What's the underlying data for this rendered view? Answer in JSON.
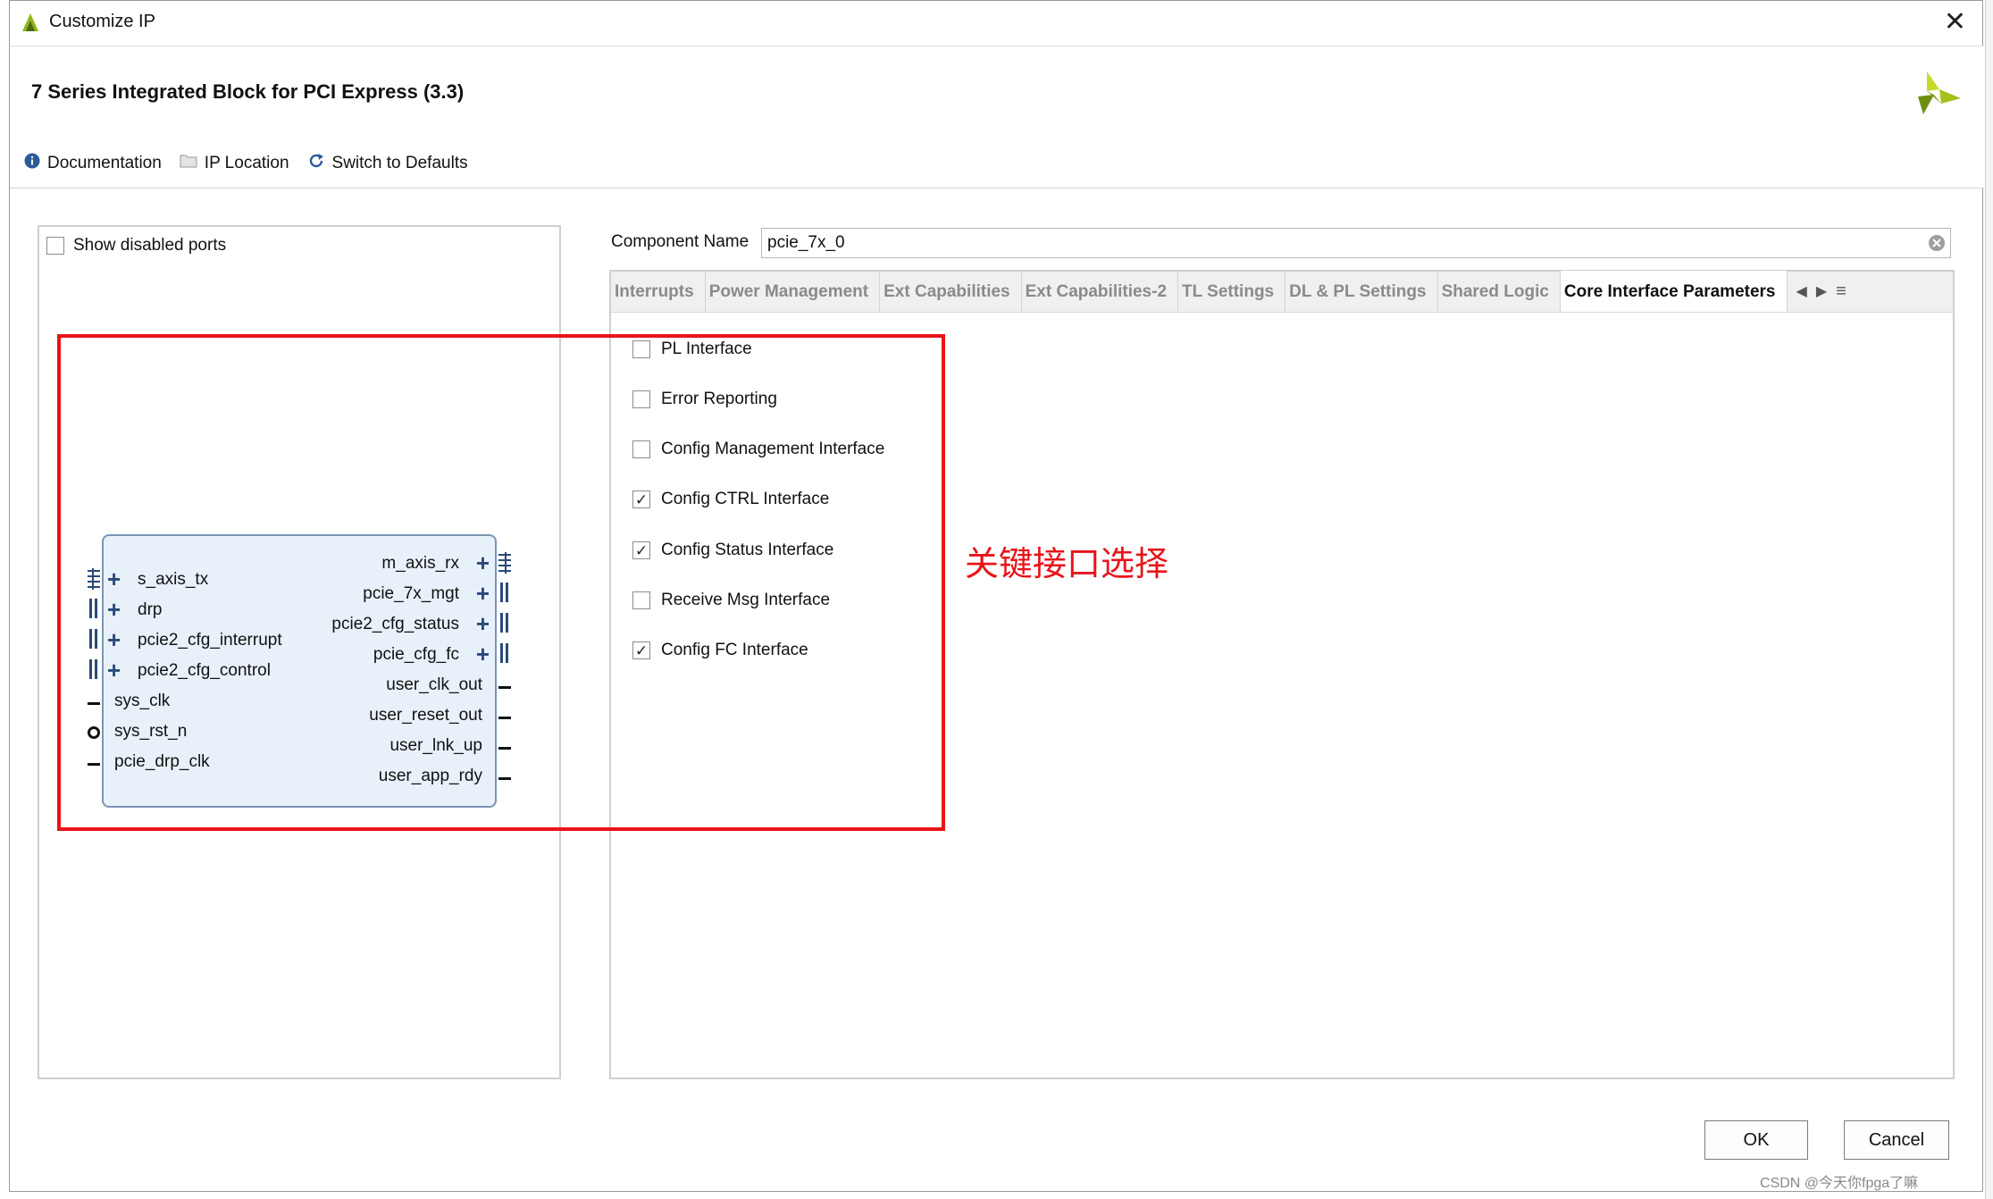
{
  "window": {
    "title": "Customize IP",
    "close_glyph": "✕",
    "ip_title": "7 Series Integrated Block for PCI Express (3.3)"
  },
  "toolbar": {
    "documentation": "Documentation",
    "ip_location": "IP Location",
    "switch_defaults": "Switch to Defaults"
  },
  "left_panel": {
    "show_disabled_ports": "Show disabled ports",
    "show_disabled_checked": false
  },
  "block": {
    "left_ports": [
      "s_axis_tx",
      "drp",
      "pcie2_cfg_interrupt",
      "pcie2_cfg_control",
      "sys_clk",
      "sys_rst_n",
      "pcie_drp_clk"
    ],
    "right_ports": [
      "m_axis_rx",
      "pcie_7x_mgt",
      "pcie2_cfg_status",
      "pcie_cfg_fc",
      "user_clk_out",
      "user_reset_out",
      "user_lnk_up",
      "user_app_rdy"
    ]
  },
  "component": {
    "label": "Component Name",
    "value": "pcie_7x_0"
  },
  "tabs": [
    {
      "label": "Interrupts",
      "active": false
    },
    {
      "label": "Power Management",
      "active": false
    },
    {
      "label": "Ext Capabilities",
      "active": false
    },
    {
      "label": "Ext Capabilities-2",
      "active": false
    },
    {
      "label": "TL Settings",
      "active": false
    },
    {
      "label": "DL & PL Settings",
      "active": false
    },
    {
      "label": "Shared Logic",
      "active": false
    },
    {
      "label": "Core Interface Parameters",
      "active": true
    }
  ],
  "options": [
    {
      "label": "PL Interface",
      "checked": false
    },
    {
      "label": "Error Reporting",
      "checked": false
    },
    {
      "label": "Config Management Interface",
      "checked": false
    },
    {
      "label": "Config CTRL Interface",
      "checked": true
    },
    {
      "label": "Config Status Interface",
      "checked": true
    },
    {
      "label": "Receive Msg Interface",
      "checked": false
    },
    {
      "label": "Config FC Interface",
      "checked": true
    }
  ],
  "annotation": {
    "text": "关键接口选择",
    "color": "#e8141a"
  },
  "buttons": {
    "ok": "OK",
    "cancel": "Cancel"
  },
  "watermark": "CSDN @今天你fpga了嘛"
}
